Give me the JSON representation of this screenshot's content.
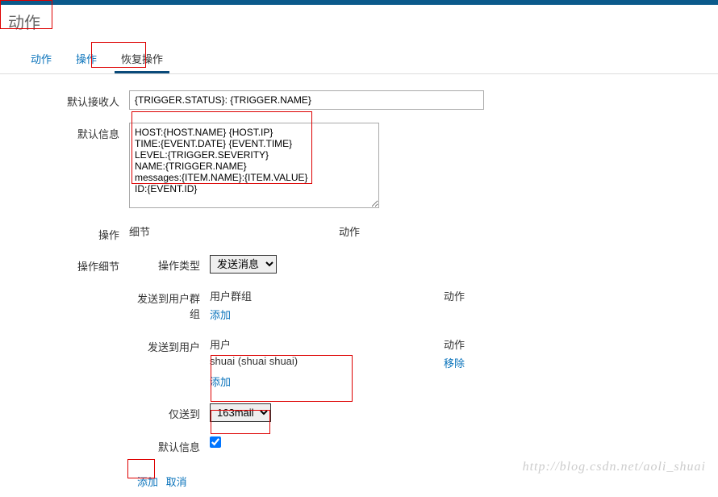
{
  "title": "动作",
  "tabs": {
    "t0": "动作",
    "t1": "操作",
    "t2": "恢复操作"
  },
  "labels": {
    "default_recipient": "默认接收人",
    "default_message": "默认信息",
    "operations": "操作",
    "operation_details": "操作细节",
    "operation_type": "操作类型",
    "send_to_groups": "发送到用户群组",
    "send_to_users": "发送到用户",
    "send_only_to": "仅送到",
    "default_msg_chk": "默认信息"
  },
  "values": {
    "recipient": "{TRIGGER.STATUS}: {TRIGGER.NAME}",
    "message": "HOST:{HOST.NAME} {HOST.IP}\nTIME:{EVENT.DATE} {EVENT.TIME}\nLEVEL:{TRIGGER.SEVERITY}\nNAME:{TRIGGER.NAME}\nmessages:{ITEM.NAME}:{ITEM.VALUE}\nID:{EVENT.ID}",
    "op_type_selected": "发送消息",
    "send_only_selected": "163mail"
  },
  "cols": {
    "detail": "细节",
    "action": "动作",
    "usergroup": "用户群组",
    "user": "用户"
  },
  "links": {
    "add": "添加",
    "remove": "移除",
    "cancel": "取消"
  },
  "users": [
    {
      "name": "shuai (shuai shuai)"
    }
  ],
  "watermark": "http://blog.csdn.net/aoli_shuai"
}
